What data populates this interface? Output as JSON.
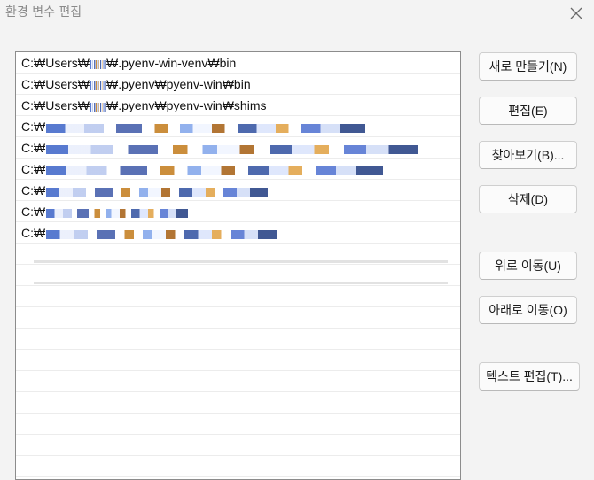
{
  "window": {
    "title": "환경 변수 편집"
  },
  "list": {
    "items": [
      {
        "prefix": "C:₩Users₩",
        "suffix": "₩.pyenv-win-venv₩bin",
        "redacted": true
      },
      {
        "prefix": "C:₩Users₩",
        "suffix": "₩.pyenv₩pyenv-win₩bin",
        "redacted": true
      },
      {
        "prefix": "C:₩Users₩",
        "suffix": "₩.pyenv₩pyenv-win₩shims",
        "redacted": true
      },
      {
        "prefix": "C:₩",
        "suffix": "",
        "redacted": true
      },
      {
        "prefix": "C:₩",
        "suffix": "",
        "redacted": true
      },
      {
        "prefix": "C:₩",
        "suffix": "",
        "redacted": true
      },
      {
        "prefix": "C:₩",
        "suffix": "",
        "redacted": true
      },
      {
        "prefix": "C:₩",
        "suffix": "",
        "redacted": true
      },
      {
        "prefix": "C:₩",
        "suffix": "",
        "redacted": true
      }
    ]
  },
  "buttons": {
    "new": "새로 만들기(N)",
    "edit": "편집(E)",
    "browse": "찾아보기(B)...",
    "delete": "삭제(D)",
    "move_up": "위로 이동(U)",
    "move_down": "아래로 이동(O)",
    "edit_text": "텍스트 편집(T)..."
  }
}
